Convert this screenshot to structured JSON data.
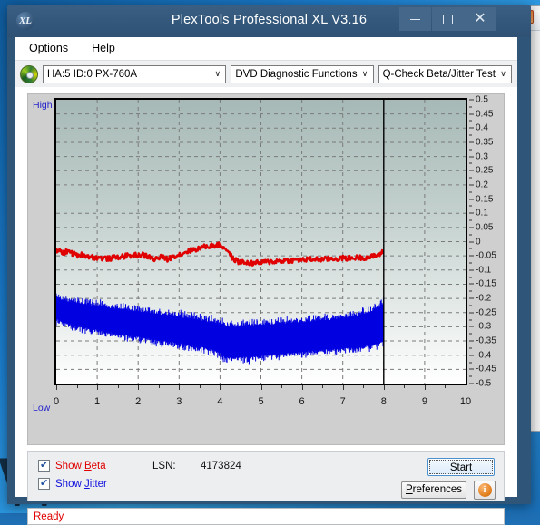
{
  "window": {
    "title": "PlexTools Professional XL V3.16",
    "app_icon": "XL",
    "minimize_label": "minimize",
    "maximize_label": "maximize",
    "close_label": "✕"
  },
  "menubar": {
    "items": [
      {
        "label": "Options",
        "accel": "O"
      },
      {
        "label": "Help",
        "accel": "H"
      }
    ]
  },
  "toolbar": {
    "drive_icon": "disc-icon",
    "drive_select": {
      "value": "HA:5 ID:0  PX-760A",
      "arrow": "∨"
    },
    "function_select": {
      "value": "DVD Diagnostic Functions",
      "arrow": "∨"
    },
    "test_select": {
      "value": "Q-Check Beta/Jitter Test",
      "arrow": "∨"
    }
  },
  "chart_labels": {
    "high": "High",
    "low": "Low"
  },
  "controls": {
    "show_beta": {
      "label_pre": "Show ",
      "label_accel": "B",
      "label_post": "eta",
      "checked": true
    },
    "show_jitter": {
      "label_pre": "Show ",
      "label_accel": "J",
      "label_post": "itter",
      "checked": true
    },
    "lsn_label": "LSN:",
    "lsn_value": "4173824",
    "start_button": {
      "pre": "St",
      "accel": "a",
      "post": "rt"
    },
    "preferences_button": {
      "pre": "",
      "accel": "P",
      "post": "references"
    },
    "info_button": "i"
  },
  "statusbar": {
    "text": "Ready"
  },
  "background": {
    "desktop_glyphs": "W",
    "bg_window": {
      "menu": "!",
      "body": "S"
    }
  },
  "chart_data": {
    "type": "line",
    "title": "Q-Check Beta/Jitter Test",
    "xlabel": "",
    "ylabel": "",
    "xlim": [
      0,
      10
    ],
    "ylim": [
      -0.5,
      0.5
    ],
    "xticks": [
      0,
      1,
      2,
      3,
      4,
      5,
      6,
      7,
      8,
      9,
      10
    ],
    "yticks": [
      0.5,
      0.45,
      0.4,
      0.35,
      0.3,
      0.25,
      0.2,
      0.15,
      0.1,
      0.05,
      0,
      -0.05,
      -0.1,
      -0.15,
      -0.2,
      -0.25,
      -0.3,
      -0.35,
      -0.4,
      -0.45,
      -0.5
    ],
    "grid": true,
    "grid_style": "dashed",
    "y_axis_endpoint_labels": {
      "top": "High",
      "bottom": "Low"
    },
    "data_end_marker_x": 8,
    "legend": [
      {
        "name": "Beta",
        "color": "#e00000"
      },
      {
        "name": "Jitter",
        "color": "#0000e0"
      }
    ],
    "series": [
      {
        "name": "Beta",
        "color": "#e00000",
        "type": "line",
        "x": [
          0.0,
          0.16,
          0.32,
          0.48,
          0.64,
          0.8,
          0.96,
          1.12,
          1.28,
          1.44,
          1.6,
          1.76,
          1.92,
          2.08,
          2.24,
          2.4,
          2.56,
          2.72,
          2.88,
          3.04,
          3.2,
          3.36,
          3.52,
          3.68,
          3.84,
          4.0,
          4.16,
          4.32,
          4.48,
          4.64,
          4.8,
          4.96,
          5.12,
          5.28,
          5.44,
          5.6,
          5.76,
          5.92,
          6.08,
          6.24,
          6.4,
          6.56,
          6.72,
          6.88,
          7.04,
          7.2,
          7.36,
          7.52,
          7.68,
          7.84,
          8.0
        ],
        "y": [
          -0.03,
          -0.038,
          -0.034,
          -0.048,
          -0.046,
          -0.052,
          -0.056,
          -0.058,
          -0.06,
          -0.056,
          -0.052,
          -0.05,
          -0.048,
          -0.046,
          -0.052,
          -0.062,
          -0.054,
          -0.062,
          -0.05,
          -0.044,
          -0.034,
          -0.028,
          -0.022,
          -0.016,
          -0.014,
          -0.012,
          -0.026,
          -0.062,
          -0.072,
          -0.074,
          -0.076,
          -0.074,
          -0.072,
          -0.07,
          -0.068,
          -0.066,
          -0.066,
          -0.064,
          -0.064,
          -0.062,
          -0.062,
          -0.062,
          -0.06,
          -0.06,
          -0.058,
          -0.058,
          -0.056,
          -0.056,
          -0.054,
          -0.048,
          -0.036
        ]
      },
      {
        "name": "Jitter",
        "color": "#0000e0",
        "type": "band",
        "x": [
          0.0,
          0.16,
          0.32,
          0.48,
          0.64,
          0.8,
          0.96,
          1.12,
          1.28,
          1.44,
          1.6,
          1.76,
          1.92,
          2.08,
          2.24,
          2.4,
          2.56,
          2.72,
          2.88,
          3.04,
          3.2,
          3.36,
          3.52,
          3.68,
          3.84,
          4.0,
          4.16,
          4.32,
          4.48,
          4.64,
          4.8,
          4.96,
          5.12,
          5.28,
          5.44,
          5.6,
          5.76,
          5.92,
          6.08,
          6.24,
          6.4,
          6.56,
          6.72,
          6.88,
          7.04,
          7.2,
          7.36,
          7.52,
          7.68,
          7.84,
          8.0
        ],
        "y_upper": [
          -0.2,
          -0.208,
          -0.212,
          -0.216,
          -0.22,
          -0.224,
          -0.228,
          -0.23,
          -0.234,
          -0.238,
          -0.24,
          -0.244,
          -0.246,
          -0.25,
          -0.252,
          -0.256,
          -0.258,
          -0.262,
          -0.264,
          -0.268,
          -0.272,
          -0.274,
          -0.278,
          -0.282,
          -0.286,
          -0.292,
          -0.3,
          -0.302,
          -0.3,
          -0.298,
          -0.296,
          -0.294,
          -0.292,
          -0.292,
          -0.29,
          -0.29,
          -0.288,
          -0.286,
          -0.284,
          -0.282,
          -0.28,
          -0.278,
          -0.276,
          -0.274,
          -0.27,
          -0.266,
          -0.262,
          -0.256,
          -0.248,
          -0.236,
          -0.22
        ],
        "y_lower": [
          -0.272,
          -0.282,
          -0.288,
          -0.294,
          -0.298,
          -0.302,
          -0.308,
          -0.312,
          -0.316,
          -0.32,
          -0.324,
          -0.328,
          -0.332,
          -0.336,
          -0.34,
          -0.344,
          -0.346,
          -0.35,
          -0.354,
          -0.358,
          -0.362,
          -0.366,
          -0.37,
          -0.374,
          -0.38,
          -0.392,
          -0.406,
          -0.408,
          -0.406,
          -0.404,
          -0.402,
          -0.4,
          -0.398,
          -0.396,
          -0.394,
          -0.392,
          -0.39,
          -0.388,
          -0.386,
          -0.384,
          -0.382,
          -0.38,
          -0.378,
          -0.376,
          -0.374,
          -0.372,
          -0.37,
          -0.368,
          -0.364,
          -0.358,
          -0.348
        ]
      }
    ]
  }
}
